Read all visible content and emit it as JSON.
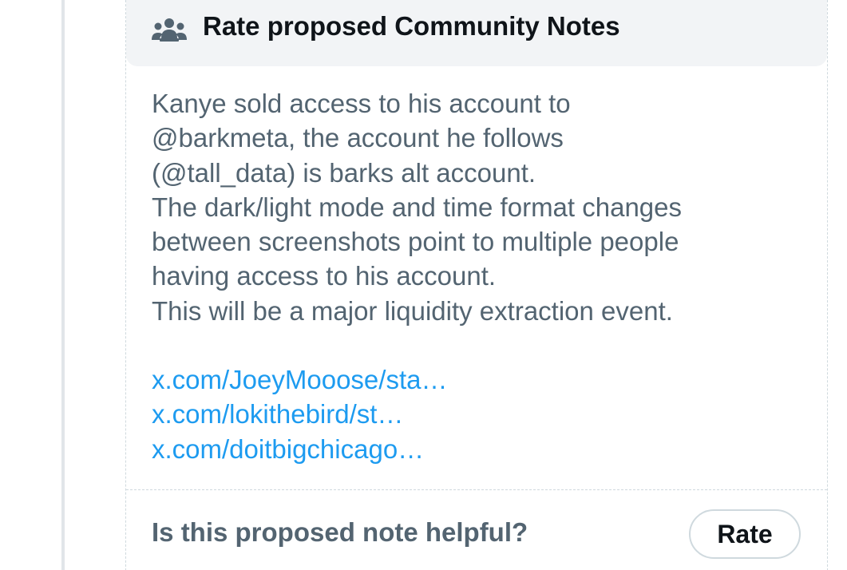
{
  "header": {
    "icon": "people-group-icon",
    "title": "Rate proposed Community Notes"
  },
  "note": {
    "lines": [
      "Kanye sold access to his account to",
      "@barkmeta, the account he follows",
      "(@tall_data) is barks alt account.",
      "The dark/light mode and time format changes",
      "between screenshots point to multiple people",
      "having access to his account.",
      "This will be a major liquidity extraction event."
    ],
    "links": [
      "x.com/JoeyMooose/sta…",
      "x.com/lokithebird/st…",
      "x.com/doitbigchicago…"
    ]
  },
  "footer": {
    "question": "Is this proposed note helpful?",
    "rate_label": "Rate"
  },
  "colors": {
    "text_primary": "#0f1419",
    "text_secondary": "#536471",
    "link": "#1d9bf0",
    "header_bg": "#f2f4f6",
    "border": "#cfd9de"
  }
}
